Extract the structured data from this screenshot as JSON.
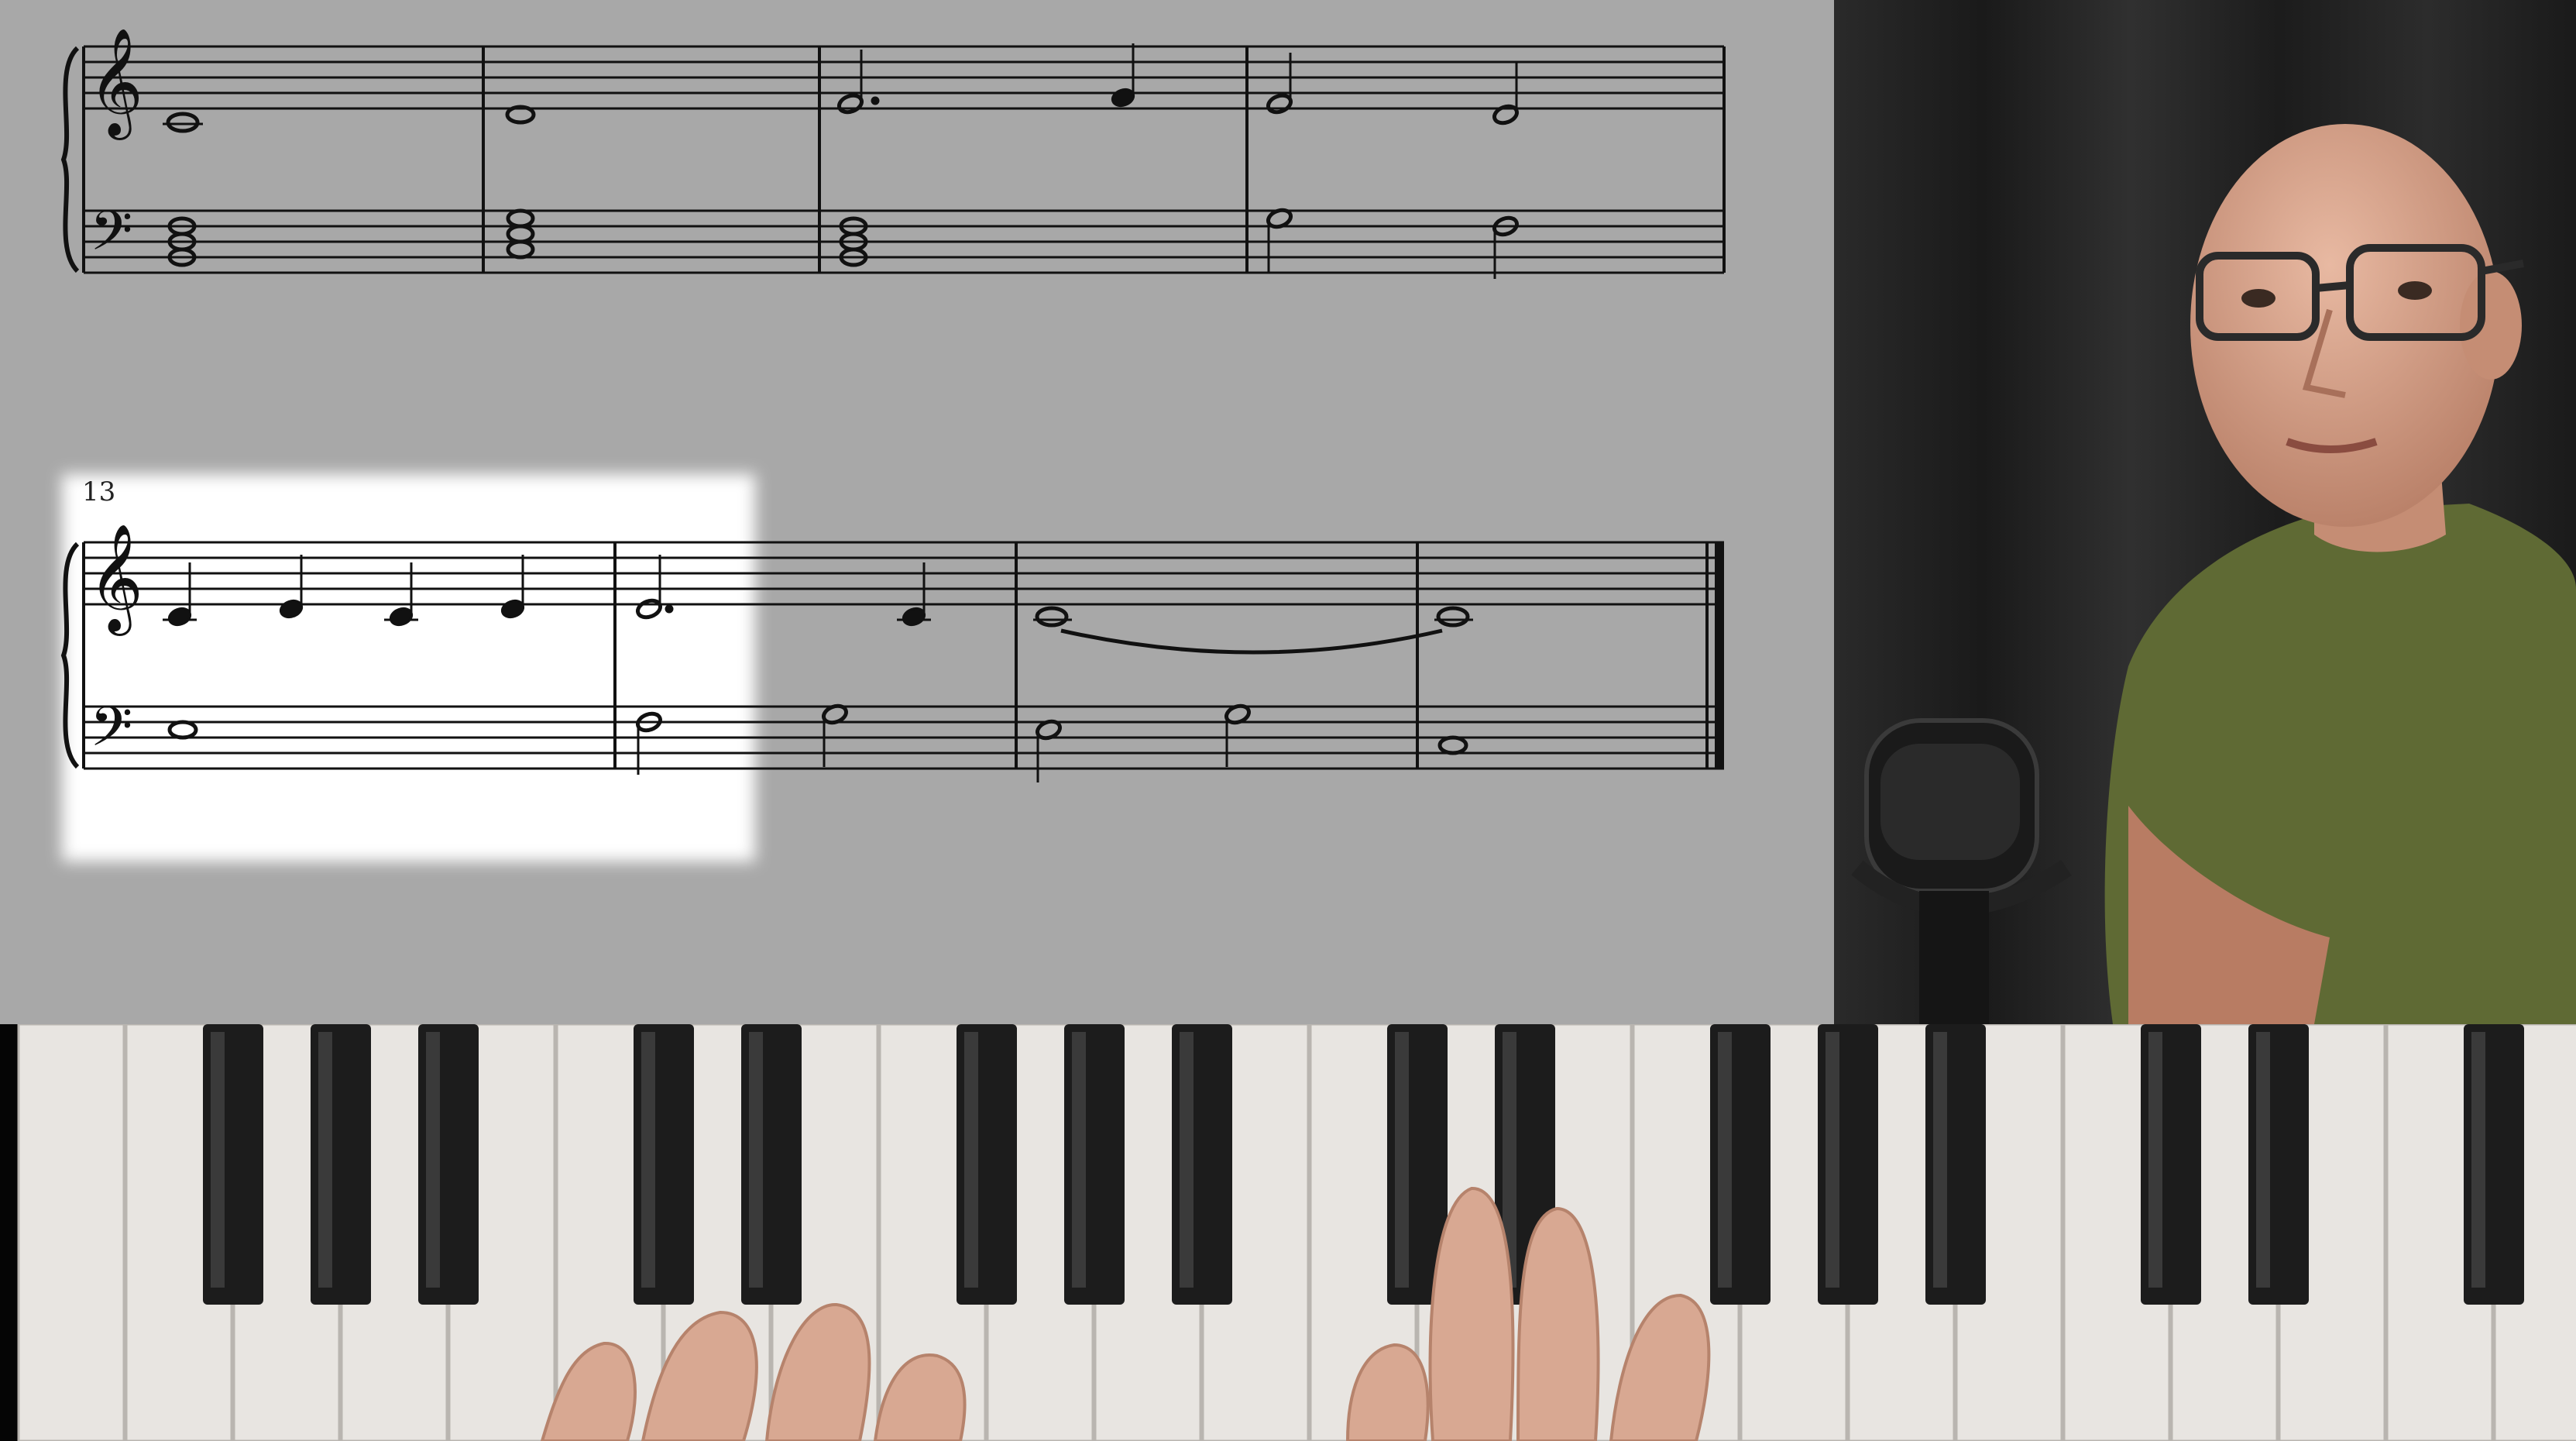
{
  "score": {
    "system_2_measure_number": "13"
  },
  "colors": {
    "score_background": "#a8a8a8",
    "highlight": "#ffffff",
    "ink": "#111111",
    "curtain": "#262626",
    "shirt": "#5f6a34",
    "skin": "#d9a58c",
    "white_key": "#e8e5e1",
    "black_key": "#1c1c1c"
  },
  "icons": {
    "treble_clef": "treble-clef-icon",
    "bass_clef": "bass-clef-icon",
    "microphone": "microphone-icon"
  }
}
